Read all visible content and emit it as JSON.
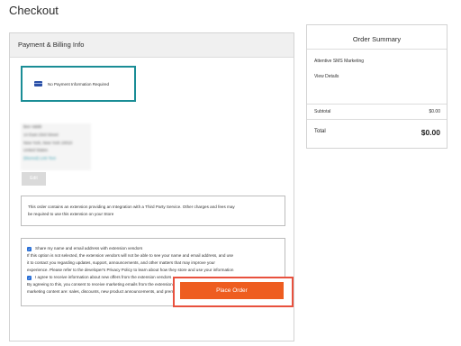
{
  "page": {
    "title": "Checkout"
  },
  "payment_billing": {
    "header": "Payment & Billing Info",
    "payment_method_text": "No Payment Information Required",
    "address_lines": [
      "Ben Valdé",
      "14 East 23rd Street",
      "New York, New York 10010",
      "United States"
    ],
    "address_link": "(blurred) Link Text",
    "edit_label": "Edit"
  },
  "notice": {
    "line1": "This order contains an extension providing an Integration with a Third Party Service. Other charges and fees may",
    "line2": "be required to use this extension on your Store"
  },
  "consent": {
    "share_label": "Share my name and email address with extension vendors",
    "share_desc": [
      "If this option is not selected, the extension vendors will not be able to see your name and email address, and use",
      "it to contact you regarding updates, support, announcements, and other matters that may improve your",
      "experience. Please refer to the developer's Privacy Policy to learn about how they store and use your information"
    ],
    "offers_label": "I agree to receive information about new offers from the extension vendors",
    "offers_desc": [
      "By agreeing to this, you consent to receive marketing emails from the extension vendors. Some examples of the",
      "marketing content are: sales, discounts, new product announcements, and premium plan availability notifications"
    ]
  },
  "actions": {
    "place_order_label": "Place Order"
  },
  "summary": {
    "title": "Order Summary",
    "item_name": "Attentive SMS Marketing",
    "view_details": "View Details",
    "subtotal_label": "Subtotal",
    "subtotal_value": "$0.00",
    "total_label": "Total",
    "total_value": "$0.00"
  },
  "colors": {
    "accent": "#ee5d20",
    "highlight": "#e8513e",
    "payment_border": "#1a8d96",
    "checkbox": "#2a6fd6"
  }
}
